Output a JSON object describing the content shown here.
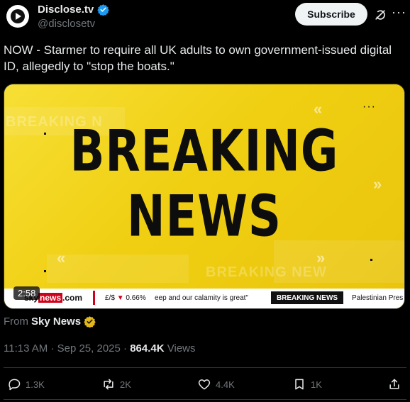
{
  "author": {
    "name": "Disclose.tv",
    "handle": "@disclosetv",
    "verified_color": "#1d9bf0"
  },
  "header": {
    "subscribe_label": "Subscribe",
    "grok_icon": "grok-icon",
    "more_icon": "more-icon"
  },
  "tweet": {
    "text": "NOW - Starmer to require all UK adults to own government-issued digital ID, allegedly to \"stop the boats.\""
  },
  "media": {
    "headline_line1": "BREAKING",
    "headline_line2": "NEWS",
    "watermark_top": "BREAKING N",
    "watermark_bottom": "BREAKING NEW",
    "duration": "2:58",
    "ticker": {
      "logo_prefix": "sky",
      "logo_red": "news",
      "logo_suffix": ".com",
      "rate_label": "£/$",
      "rate_arrow": "▼",
      "rate_value": "0.66%",
      "scroll_text": "eep and our calamity is great\"",
      "breaking_label": "BREAKING NEWS",
      "right_text": "Palestinian Pres"
    },
    "accent_color": "#f2d21a"
  },
  "source": {
    "from_label": "From",
    "name": "Sky News",
    "badge_color": "#e2b719"
  },
  "meta": {
    "time": "11:13 AM",
    "date": "Sep 25, 2025",
    "views_count": "864.4K",
    "views_label": "Views"
  },
  "actions": {
    "replies": "1.3K",
    "reposts": "2K",
    "likes": "4.4K",
    "bookmarks": "1K"
  }
}
